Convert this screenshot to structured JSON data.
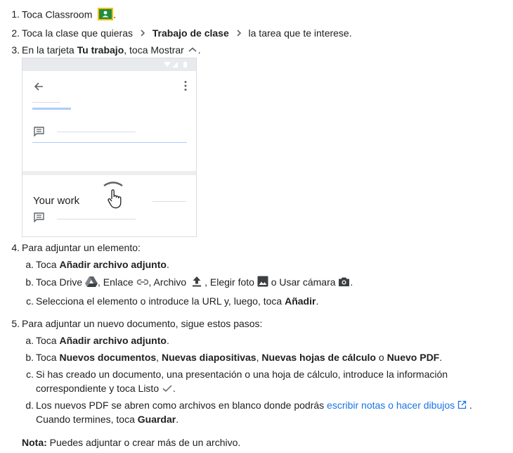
{
  "steps": {
    "s1": {
      "num": "1.",
      "text": "Toca Classroom",
      "end": "."
    },
    "s2": {
      "num": "2.",
      "t1": "Toca la clase que quieras",
      "b1": "Trabajo de clase",
      "t2": "la tarea que te interese."
    },
    "s3": {
      "num": "3.",
      "t1": "En la tarjeta ",
      "b1": "Tu trabajo",
      "t2": ", toca Mostrar",
      "end": "."
    },
    "mock": {
      "card_label": "Your work"
    },
    "s4": {
      "num": "4.",
      "text": "Para adjuntar un elemento:",
      "a": {
        "letter": "a.",
        "t1": "Toca ",
        "b1": "Añadir archivo adjunto",
        "end": "."
      },
      "b": {
        "letter": "b.",
        "t1": "Toca Drive",
        "t2": ", Enlace",
        "t3": ", Archivo",
        "t4": ", Elegir foto",
        "t5": "o Usar cámara",
        "end": "."
      },
      "c": {
        "letter": "c.",
        "t1": "Selecciona el elemento o introduce la URL y, luego, toca ",
        "b1": "Añadir",
        "end": "."
      }
    },
    "s5": {
      "num": "5.",
      "text": "Para adjuntar un nuevo documento, sigue estos pasos:",
      "a": {
        "letter": "a.",
        "t1": "Toca ",
        "b1": "Añadir archivo adjunto",
        "end": "."
      },
      "b": {
        "letter": "b.",
        "t1": "Toca ",
        "b1": "Nuevos documentos",
        "t2": ", ",
        "b2": "Nuevas diapositivas",
        "t3": ", ",
        "b3": "Nuevas hojas de cálculo",
        "t4": " o ",
        "b4": "Nuevo PDF",
        "end": "."
      },
      "c": {
        "letter": "c.",
        "line1": "Si has creado un documento, una presentación o una hoja de cálculo, introduce la información",
        "line2": "correspondiente y toca Listo",
        "end": "."
      },
      "d": {
        "letter": "d.",
        "t1": "Los nuevos PDF se abren como archivos en blanco donde podrás ",
        "link": "escribir notas o hacer dibujos",
        "end": ".",
        "line2a": "Cuando termines, toca ",
        "b1": "Guardar",
        "line2end": "."
      }
    }
  },
  "note": {
    "label": "Nota:",
    "text": " Puedes adjuntar o crear más de un archivo."
  },
  "colors": {
    "link": "#1a73e8",
    "classroom_green": "#1e8e3e",
    "classroom_yellow": "#fbbc04"
  },
  "icons": [
    "classroom-icon",
    "chevron-right-icon",
    "expand-less-icon",
    "drive-icon",
    "link-icon",
    "upload-icon",
    "image-icon",
    "camera-icon",
    "check-icon",
    "open-in-new-icon",
    "hand-pointer-icon"
  ]
}
